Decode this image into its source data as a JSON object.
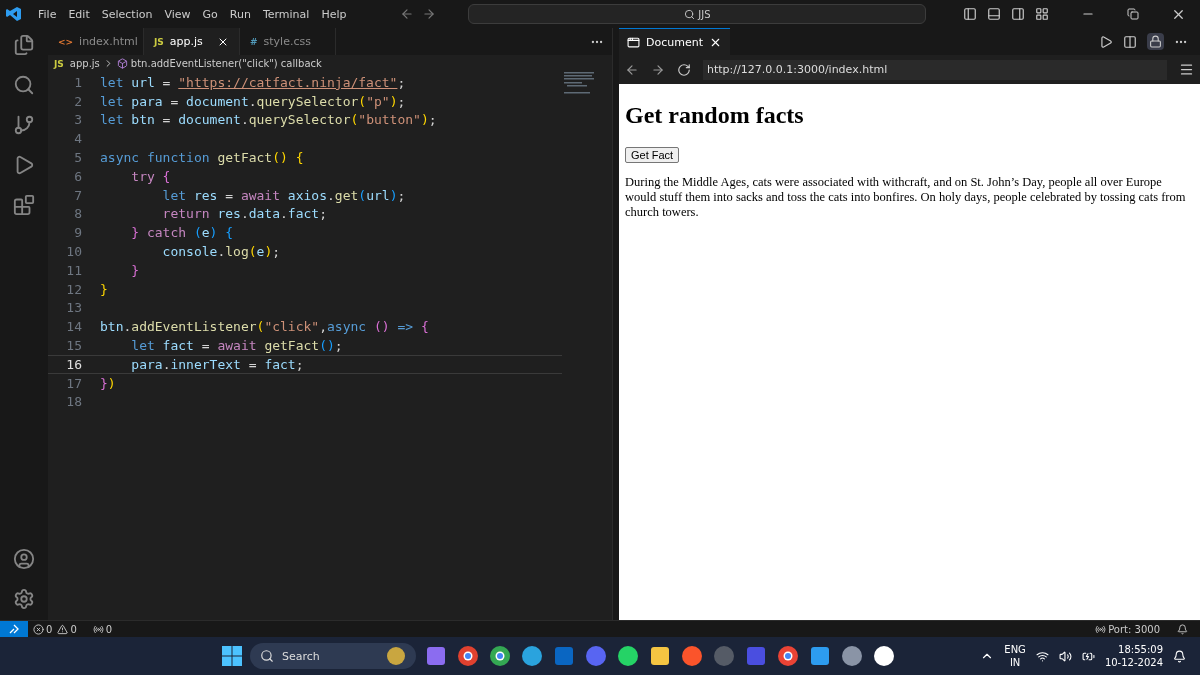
{
  "menu": [
    "File",
    "Edit",
    "Selection",
    "View",
    "Go",
    "Run",
    "Terminal",
    "Help"
  ],
  "command_center": {
    "value": "JJS"
  },
  "editor_tabs": [
    {
      "icon": "<>",
      "label": "index.html",
      "kind": "html",
      "selected": false
    },
    {
      "icon": "JS",
      "label": "app.js",
      "kind": "js",
      "selected": true
    },
    {
      "icon": "#",
      "label": "style.css",
      "kind": "css",
      "selected": false
    }
  ],
  "breadcrumb": {
    "icon": "JS",
    "file": "app.js",
    "symbol": "btn.addEventListener(\"click\") callback"
  },
  "code": {
    "lines": [
      {
        "number": "1",
        "current": false,
        "tokens": [
          {
            "kind": "keyword",
            "text": "let"
          },
          {
            "kind": "variable",
            "text": " url"
          },
          {
            "kind": "plain",
            "text": " = "
          },
          {
            "kind": "link",
            "text": "\"https://catfact.ninja/fact\""
          },
          {
            "kind": "plain",
            "text": ";"
          }
        ]
      },
      {
        "number": "2",
        "current": false,
        "tokens": [
          {
            "kind": "keyword",
            "text": "let"
          },
          {
            "kind": "variable",
            "text": " para"
          },
          {
            "kind": "plain",
            "text": " = "
          },
          {
            "kind": "variable",
            "text": "document"
          },
          {
            "kind": "plain",
            "text": "."
          },
          {
            "kind": "function",
            "text": "querySelector"
          },
          {
            "kind": "bracket1",
            "text": "("
          },
          {
            "kind": "string",
            "text": "\"p\""
          },
          {
            "kind": "bracket1",
            "text": ")"
          },
          {
            "kind": "plain",
            "text": ";"
          }
        ]
      },
      {
        "number": "3",
        "current": false,
        "tokens": [
          {
            "kind": "keyword",
            "text": "let"
          },
          {
            "kind": "variable",
            "text": " btn"
          },
          {
            "kind": "plain",
            "text": " = "
          },
          {
            "kind": "variable",
            "text": "document"
          },
          {
            "kind": "plain",
            "text": "."
          },
          {
            "kind": "function",
            "text": "querySelector"
          },
          {
            "kind": "bracket1",
            "text": "("
          },
          {
            "kind": "string",
            "text": "\"button\""
          },
          {
            "kind": "bracket1",
            "text": ")"
          },
          {
            "kind": "plain",
            "text": ";"
          }
        ]
      },
      {
        "number": "4",
        "current": false
      },
      {
        "number": "5",
        "current": false,
        "tokens": [
          {
            "kind": "keyword",
            "text": "async function"
          },
          {
            "kind": "function",
            "text": " getFact"
          },
          {
            "kind": "bracket1",
            "text": "() {"
          }
        ]
      },
      {
        "number": "6",
        "current": false,
        "tokens": [
          {
            "kind": "control",
            "text": "    try"
          },
          {
            "kind": "bracket2",
            "text": " {"
          }
        ]
      },
      {
        "number": "7",
        "current": false,
        "tokens": [
          {
            "kind": "keyword",
            "text": "        let"
          },
          {
            "kind": "variable",
            "text": " res"
          },
          {
            "kind": "plain",
            "text": " = "
          },
          {
            "kind": "control",
            "text": "await"
          },
          {
            "kind": "variable",
            "text": " axios"
          },
          {
            "kind": "plain",
            "text": "."
          },
          {
            "kind": "function",
            "text": "get"
          },
          {
            "kind": "bracket3",
            "text": "("
          },
          {
            "kind": "variable",
            "text": "url"
          },
          {
            "kind": "bracket3",
            "text": ")"
          },
          {
            "kind": "plain",
            "text": ";"
          }
        ]
      },
      {
        "number": "8",
        "current": false,
        "tokens": [
          {
            "kind": "control",
            "text": "        return"
          },
          {
            "kind": "variable",
            "text": " res"
          },
          {
            "kind": "plain",
            "text": "."
          },
          {
            "kind": "variable",
            "text": "data"
          },
          {
            "kind": "plain",
            "text": "."
          },
          {
            "kind": "variable",
            "text": "fact"
          },
          {
            "kind": "plain",
            "text": ";"
          }
        ]
      },
      {
        "number": "9",
        "current": false,
        "tokens": [
          {
            "kind": "bracket2",
            "text": "    }"
          },
          {
            "kind": "control",
            "text": " catch"
          },
          {
            "kind": "bracket3",
            "text": " ("
          },
          {
            "kind": "variable",
            "text": "e"
          },
          {
            "kind": "bracket3",
            "text": ") {"
          }
        ]
      },
      {
        "number": "10",
        "current": false,
        "tokens": [
          {
            "kind": "variable",
            "text": "        console"
          },
          {
            "kind": "plain",
            "text": "."
          },
          {
            "kind": "function",
            "text": "log"
          },
          {
            "kind": "bracket1",
            "text": "("
          },
          {
            "kind": "variable",
            "text": "e"
          },
          {
            "kind": "bracket1",
            "text": ")"
          },
          {
            "kind": "plain",
            "text": ";"
          }
        ]
      },
      {
        "number": "11",
        "current": false,
        "tokens": [
          {
            "kind": "bracket2",
            "text": "    }"
          }
        ]
      },
      {
        "number": "12",
        "current": false,
        "tokens": [
          {
            "kind": "bracket1",
            "text": "}"
          }
        ]
      },
      {
        "number": "13",
        "current": false
      },
      {
        "number": "14",
        "current": false,
        "tokens": [
          {
            "kind": "variable",
            "text": "btn"
          },
          {
            "kind": "plain",
            "text": "."
          },
          {
            "kind": "function",
            "text": "addEventListener"
          },
          {
            "kind": "bracket1",
            "text": "("
          },
          {
            "kind": "string",
            "text": "\"click\""
          },
          {
            "kind": "plain",
            "text": ","
          },
          {
            "kind": "keyword",
            "text": "async"
          },
          {
            "kind": "bracket2",
            "text": " ()"
          },
          {
            "kind": "keyword",
            "text": " =>"
          },
          {
            "kind": "bracket2",
            "text": " {"
          }
        ]
      },
      {
        "number": "15",
        "current": false,
        "tokens": [
          {
            "kind": "keyword",
            "text": "    let"
          },
          {
            "kind": "variable",
            "text": " fact"
          },
          {
            "kind": "plain",
            "text": " = "
          },
          {
            "kind": "control",
            "text": "await"
          },
          {
            "kind": "function",
            "text": " getFact"
          },
          {
            "kind": "bracket3",
            "text": "()"
          },
          {
            "kind": "plain",
            "text": ";"
          }
        ]
      },
      {
        "number": "16",
        "current": true,
        "tokens": [
          {
            "kind": "variable",
            "text": "    para"
          },
          {
            "kind": "plain",
            "text": "."
          },
          {
            "kind": "variable",
            "text": "innerText"
          },
          {
            "kind": "plain",
            "text": " = "
          },
          {
            "kind": "variable",
            "text": "fact"
          },
          {
            "kind": "plain",
            "text": ";"
          }
        ]
      },
      {
        "number": "17",
        "current": false,
        "tokens": [
          {
            "kind": "bracket2",
            "text": "}"
          },
          {
            "kind": "bracket1",
            "text": ")"
          }
        ]
      },
      {
        "number": "18",
        "current": false
      }
    ]
  },
  "preview": {
    "tab": "Document",
    "url": "http://127.0.0.1:3000/index.html",
    "page": {
      "heading": "Get random facts",
      "button": "Get Fact",
      "paragraph": "During the Middle Ages, cats were associated with withcraft, and on St. John’s Day, people all over Europe would stuff them into sacks and toss the cats into bonfires. On holy days, people celebrated by tossing cats from church towers."
    }
  },
  "status_bar": {
    "errors": "0",
    "warnings": "0",
    "ports": "0",
    "port": "Port: 3000"
  },
  "taskbar": {
    "search": "Search",
    "language": "ENG",
    "region": "IN",
    "time": "18:55:09",
    "date": "10-12-2024"
  }
}
